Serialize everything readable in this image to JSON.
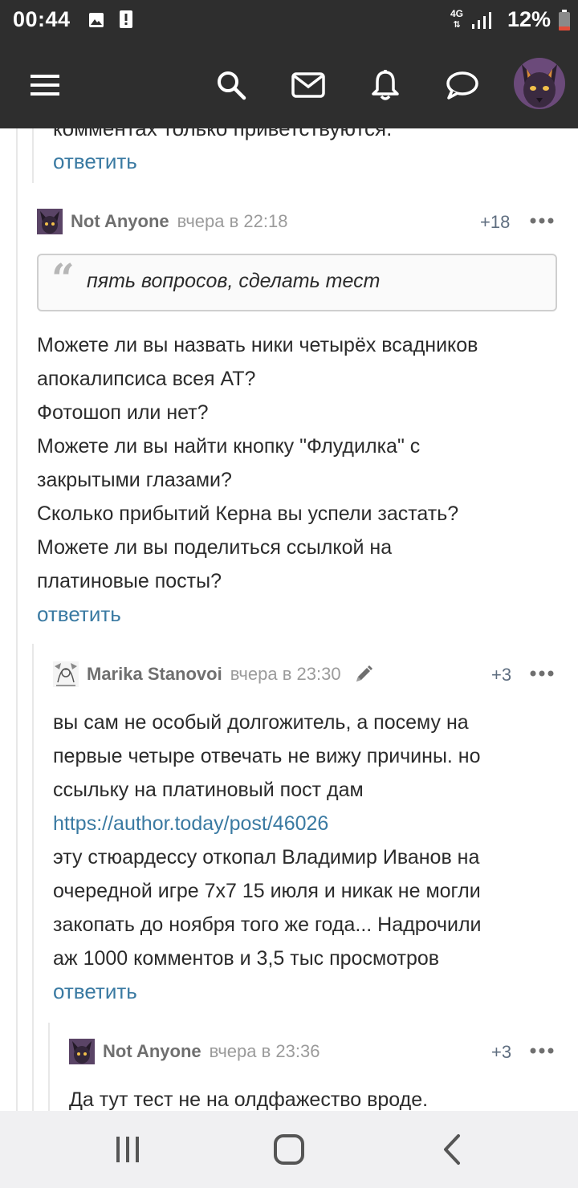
{
  "status_bar": {
    "time": "00:44",
    "network": "4G",
    "battery": "12%",
    "icons": [
      "image-icon",
      "alert-icon",
      "signal-icon",
      "battery-icon"
    ]
  },
  "header": {
    "icons": [
      "menu-icon",
      "search-icon",
      "mail-icon",
      "bell-icon",
      "chat-icon",
      "user-avatar"
    ]
  },
  "prev_comment": {
    "tail_text": "комментах только приветствуются.",
    "reply_label": "ответить"
  },
  "comments": [
    {
      "author": "Not Anyone",
      "date": "вчера в 22:18",
      "score": "+18",
      "quote": "пять вопросов, сделать тест",
      "lines": [
        "Можете ли вы назвать ники четырёх всадников",
        "апокалипсиса всея АТ?",
        "Фотошоп или нет?",
        "Можете ли вы найти кнопку \"Флудилка\" с",
        "закрытыми глазами?",
        "Сколько прибытий Керна вы успели застать?",
        "Можете ли вы поделиться ссылкой на",
        "платиновые посты?"
      ],
      "reply_label": "ответить"
    },
    {
      "author": "Marika Stanovoi",
      "date": "вчера в 23:30",
      "score": "+3",
      "lines_before_link": [
        "вы сам не особый долгожитель, а посему на",
        "первые четыре отвечать не вижу причины. но",
        "ссыльку на платиновый пост дам"
      ],
      "link": "https://author.today/post/46026",
      "lines_after_link": [
        "эту стюардессу  откопал Владимир Иванов на",
        "очередной игре 7х7 15 июля и никак не могли",
        "закопать до  ноября того же года... Надрочили",
        "аж 1000 комментов и 3,5 тыс просмотров"
      ],
      "reply_label": "ответить"
    },
    {
      "author": "Not Anyone",
      "date": "вчера в 23:36",
      "score": "+3",
      "lines": [
        "Да тут тест не на олдфажество вроде."
      ]
    }
  ],
  "colors": {
    "header_bg": "#2e2e2e",
    "link": "#3a7aa2",
    "text": "#2b2b2b",
    "author": "#6f6f6f",
    "date": "#9b9b9b",
    "score": "#5f6e80",
    "navbar_bg": "#f0f0f2"
  },
  "nav_bar": {
    "icons": [
      "recent-apps-icon",
      "home-icon",
      "back-icon"
    ]
  }
}
